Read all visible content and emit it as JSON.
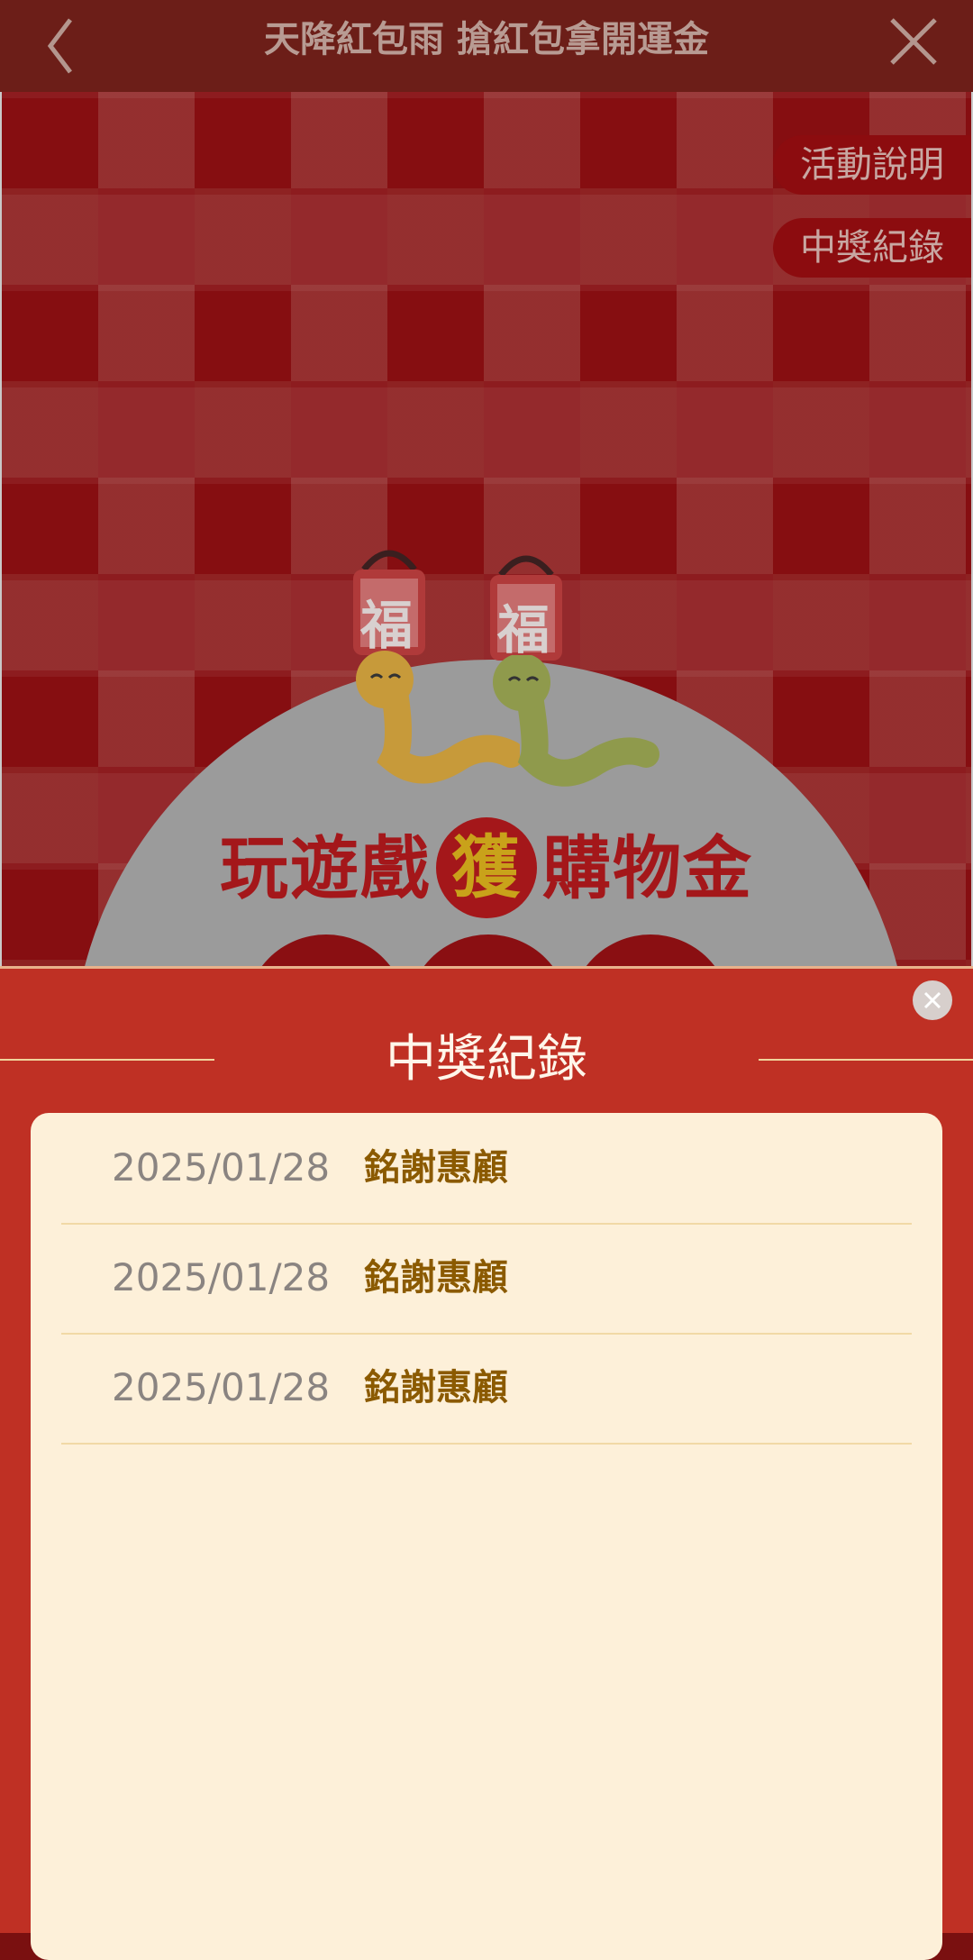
{
  "topbar": {
    "title": "天降紅包雨 搶紅包拿開運金",
    "back_icon": "chevron-left-icon",
    "close_icon": "close-icon"
  },
  "game": {
    "side_buttons": [
      "活動說明",
      "中獎紀錄"
    ],
    "bag_label": "福",
    "headline_before": "玩遊戲",
    "headline_badge": "獲",
    "headline_after": "購物金"
  },
  "records_sheet": {
    "title": "中獎紀錄",
    "close_icon": "close-circle-icon",
    "rows": [
      {
        "date": "2025/01/28",
        "prize": "銘謝惠顧"
      },
      {
        "date": "2025/01/28",
        "prize": "銘謝惠顧"
      },
      {
        "date": "2025/01/28",
        "prize": "銘謝惠顧"
      }
    ]
  },
  "colors": {
    "sheet_red": "#bf3024",
    "panel_cream": "#fdf0d9",
    "prize_brown": "#8b5a00"
  }
}
